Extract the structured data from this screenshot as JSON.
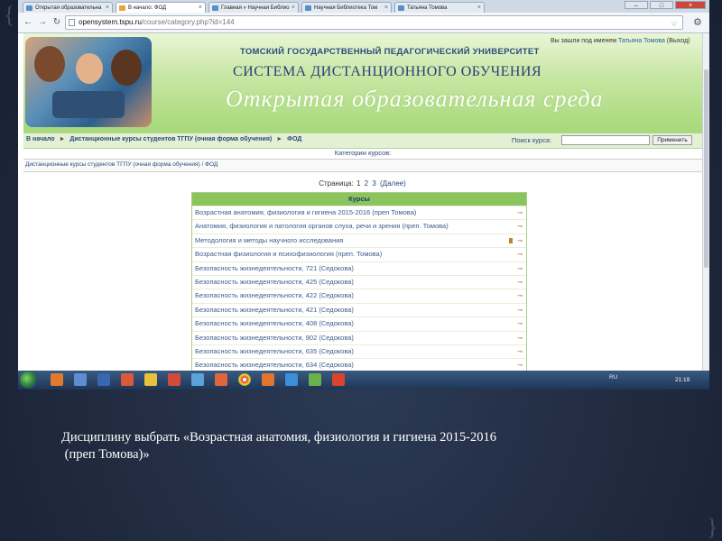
{
  "browser": {
    "tabs": [
      {
        "label": "Открытая образовательна",
        "active": false
      },
      {
        "label": "В начало: ФОД",
        "active": true
      },
      {
        "label": "Главная » Научная Библио",
        "active": false
      },
      {
        "label": "Научная Библиотека Том",
        "active": false
      },
      {
        "label": "Татьяна Томова",
        "active": false
      }
    ],
    "url_host": "opensystem.tspu.ru",
    "url_path": "/course/category.php?id=144",
    "nav": {
      "back": "←",
      "forward": "→",
      "reload": "↻"
    },
    "window_buttons": {
      "minimize": "–",
      "maximize": "□",
      "close": "×"
    }
  },
  "header": {
    "university": "ТОМСКИЙ ГОСУДАРСТВЕННЫЙ ПЕДАГОГИЧЕСКИЙ УНИВЕРСИТЕТ",
    "system": "СИСТЕМА ДИСТАНЦИОННОГО ОБУЧЕНИЯ",
    "slogan": "Открытая образовательная среда",
    "login_prefix": "Вы зашли под именем ",
    "login_user": "Татьяна Томова",
    "login_exit": "(Выход)"
  },
  "navbar": {
    "crumbs": [
      "В начало",
      "Дистанционные курсы студентов ТГПУ (очная форма обучения)",
      "ФОД"
    ],
    "search_label": "Поиск курса:",
    "search_value": "",
    "search_button": "Применить"
  },
  "categories_title": "Категории курсов:",
  "path_line": "Дистанционные курсы студентов ТГПУ (очная форма обучения) / ФОД",
  "pager": {
    "label": "Страница:",
    "pages": [
      "1",
      "2",
      "3"
    ],
    "next": "(Далее)"
  },
  "courses": {
    "header": "Курсы",
    "items": [
      "Возрастная анатомия, физиология и гигиена 2015-2016 (преп Томова)",
      "Анатомия, физиология и патология органов слуха, речи и зрения (преп. Томова)",
      "Методология и методы научного исследования",
      "Возрастная физиология и психофизиология (преп. Томова)",
      "Безопасность жизнедеятельности, 721 (Седокова)",
      "Безопасность жизнедеятельности, 425 (Седокова)",
      "Безопасность жизнедеятельности, 422 (Седокова)",
      "Безопасность жизнедеятельности, 421 (Седокова)",
      "Безопасность жизнедеятельности, 408 (Седокова)",
      "Безопасность жизнедеятельности, 902 (Седокова)",
      "Безопасность жизнедеятельности, 635 (Седокова)",
      "Безопасность жизнедеятельности, 634 (Седокова)"
    ],
    "icon": "key-icon"
  },
  "taskbar": {
    "language": "RU",
    "clock": "21:19"
  },
  "caption": {
    "line1": "Дисциплину выбрать «Возрастная анатомия, физиология и гигиена 2015-2016",
    "line2": " (преп Томова)»"
  },
  "colors": {
    "header_green": "#a7d97a",
    "link_blue": "#2a4b7c",
    "course_header": "#8bc35d",
    "slide_bg": "#1f2a40"
  }
}
